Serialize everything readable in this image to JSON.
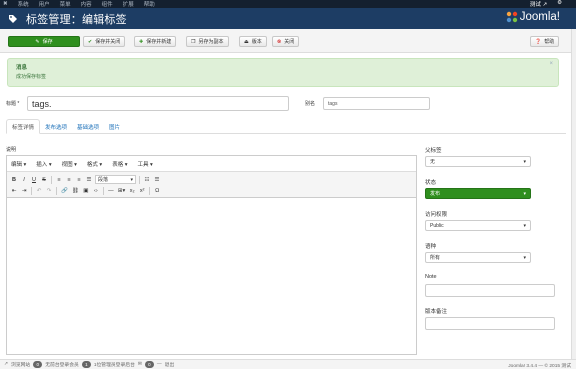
{
  "topmenu": {
    "items": [
      "系统",
      "用户",
      "菜单",
      "内容",
      "组件",
      "扩展",
      "帮助"
    ],
    "user": "测试",
    "gear": "⚙"
  },
  "header": {
    "title": "标签管理：编辑标签",
    "brand": "Joomla!"
  },
  "toolbar": {
    "save": "保存",
    "save_close": "保存并关闭",
    "save_new": "保存并新建",
    "save_copy": "另存为副本",
    "versions": "版本",
    "close": "关闭",
    "help": "帮助"
  },
  "alert": {
    "heading": "消息",
    "message": "成功保存标签"
  },
  "form": {
    "title_label": "标题 *",
    "title_value": "tags.",
    "alias_label": "别名",
    "alias_value": "tags"
  },
  "tabs": [
    "标签详情",
    "发布选项",
    "基础选项",
    "图片"
  ],
  "editor": {
    "label": "说明",
    "menus": [
      "编辑 ▾",
      "插入 ▾",
      "视图 ▾",
      "格式 ▾",
      "表格 ▾",
      "工具 ▾"
    ],
    "format_select": "段落"
  },
  "sidebar": {
    "parent_label": "父标签",
    "parent_value": "无",
    "status_label": "状态",
    "status_value": "发布",
    "access_label": "访问权限",
    "access_value": "Public",
    "language_label": "语种",
    "language_value": "所有",
    "note_label": "Note",
    "version_note_label": "版本备注"
  },
  "statusbar": {
    "view_site": "浏览网站",
    "visitors_count": "0",
    "visitors_label": "无前台登录会员",
    "admins_count": "1",
    "admins_label": "1位管理员登录后台",
    "messages_count": "0",
    "logout": "退出",
    "copyright": "Joomla! 3.4.4 — © 2015 测试"
  },
  "colors": {
    "header": "#1d3d64",
    "topmenu": "#14202f",
    "success": "#2f8f1e",
    "alert_bg": "#dff0d8",
    "link": "#1a6fb8"
  }
}
